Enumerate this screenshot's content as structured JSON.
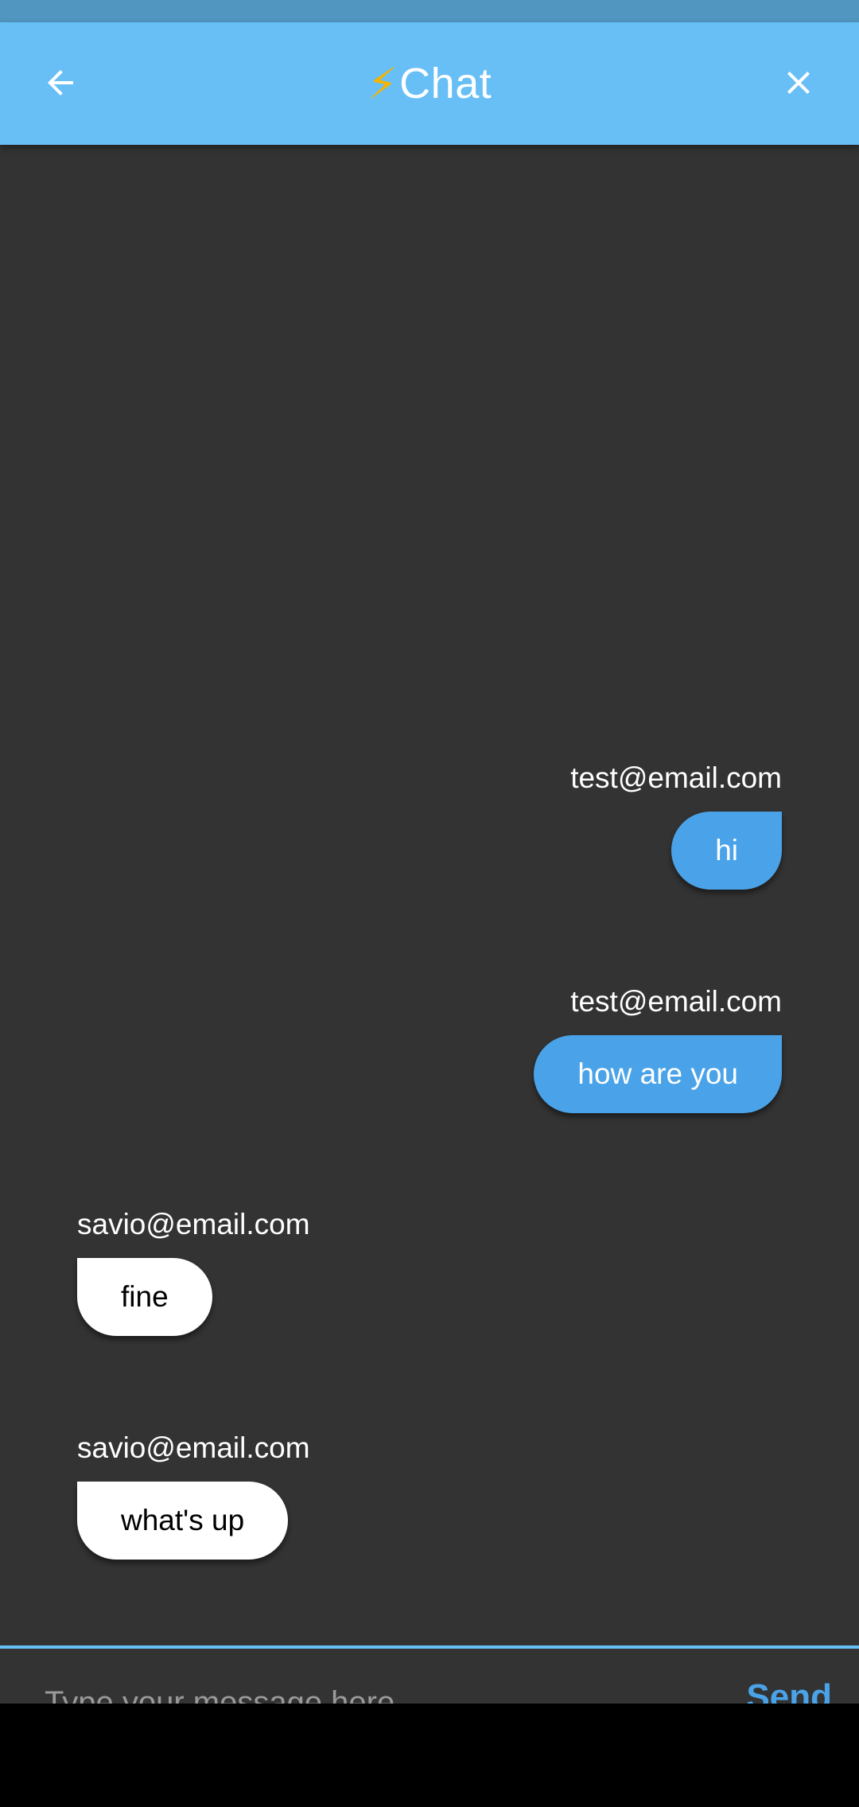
{
  "colors": {
    "status_bar": "#5196c0",
    "app_bar": "#68bff6",
    "background": "#333333",
    "sent_bubble": "#4aa3e8",
    "received_bubble": "#ffffff",
    "send_button": "#4aa3e8",
    "bolt": "#f4b400"
  },
  "header": {
    "back_icon": "arrow-back-icon",
    "bolt_icon": "lightning-bolt-icon",
    "bolt": "⚡",
    "title": "Chat",
    "close_icon": "close-icon"
  },
  "messages": [
    {
      "sender": "test@email.com",
      "text": "hi",
      "direction": "sent"
    },
    {
      "sender": "test@email.com",
      "text": "how are you",
      "direction": "sent"
    },
    {
      "sender": "savio@email.com",
      "text": "fine",
      "direction": "received"
    },
    {
      "sender": "savio@email.com",
      "text": "what's up",
      "direction": "received"
    }
  ],
  "composer": {
    "placeholder": "Type your message here",
    "value": "",
    "send_label": "Send"
  }
}
